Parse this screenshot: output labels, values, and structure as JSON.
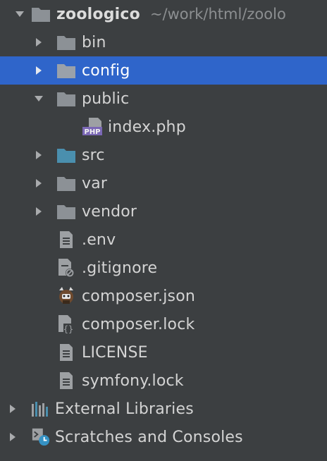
{
  "project": {
    "name": "zoologico",
    "path": "~/work/html/zoolo"
  },
  "nodes": [
    {
      "label": "bin",
      "icon": "folder-icon",
      "expanded": false,
      "selected": false
    },
    {
      "label": "config",
      "icon": "folder-icon",
      "expanded": false,
      "selected": true
    },
    {
      "label": "public",
      "icon": "folder-icon",
      "expanded": true,
      "selected": false
    },
    {
      "label": "index.php",
      "icon": "php-file-icon",
      "selected": false
    },
    {
      "label": "src",
      "icon": "source-folder-icon",
      "expanded": false,
      "selected": false
    },
    {
      "label": "var",
      "icon": "folder-icon",
      "expanded": false,
      "selected": false
    },
    {
      "label": "vendor",
      "icon": "folder-icon",
      "expanded": false,
      "selected": false
    },
    {
      "label": ".env",
      "icon": "text-file-icon",
      "selected": false
    },
    {
      "label": ".gitignore",
      "icon": "ignored-file-icon",
      "selected": false
    },
    {
      "label": "composer.json",
      "icon": "composer-icon",
      "selected": false
    },
    {
      "label": "composer.lock",
      "icon": "json-lock-file-icon",
      "selected": false
    },
    {
      "label": "LICENSE",
      "icon": "text-file-icon",
      "selected": false
    },
    {
      "label": "symfony.lock",
      "icon": "text-file-icon",
      "selected": false
    }
  ],
  "external_libraries": {
    "label": "External Libraries",
    "icon": "libraries-icon"
  },
  "scratches": {
    "label": "Scratches and Consoles",
    "icon": "scratches-icon"
  },
  "php_badge": "PHP",
  "colors": {
    "background": "#3c3f41",
    "selection": "#2f65ca",
    "folder": "#8c9196",
    "source_folder": "#4a8fae"
  }
}
